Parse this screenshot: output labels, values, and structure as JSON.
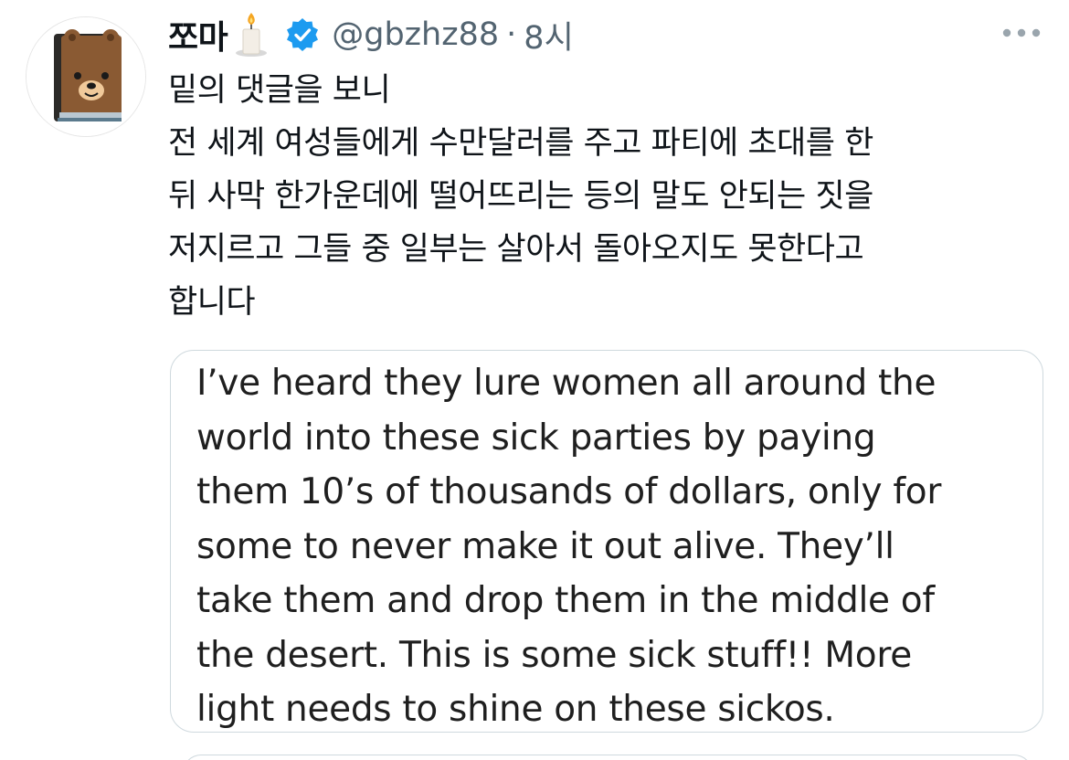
{
  "tweet": {
    "display_name": "쪼마",
    "emoji_icon": "candle-icon",
    "verified_icon": "verified-badge-icon",
    "handle": "@gbzhz88",
    "separator": "·",
    "time": "8시",
    "more_icon": "more-horizontal-icon",
    "body_lines": [
      "밑의 댓글을 보니",
      "전 세계 여성들에게 수만달러를 주고 파티에 초대를 한",
      "뒤 사막 한가운데에 떨어뜨리는 등의 말도 안되는 짓을",
      "저지르고 그들 중 일부는 살아서 돌아오지도 못한다고",
      "합니다"
    ]
  },
  "quote": {
    "lines": [
      "I’ve heard they lure women all around the",
      "world into these sick parties by paying",
      "them 10’s of thousands of dollars, only for",
      "some to never make it out alive. They’ll",
      "take them and drop them in the middle of",
      "the desert. This is some sick stuff!! More",
      "light needs to shine on these sickos."
    ]
  },
  "colors": {
    "accent_verified": "#1d9bf0",
    "secondary_text": "#536471",
    "border": "#cfd9de"
  }
}
